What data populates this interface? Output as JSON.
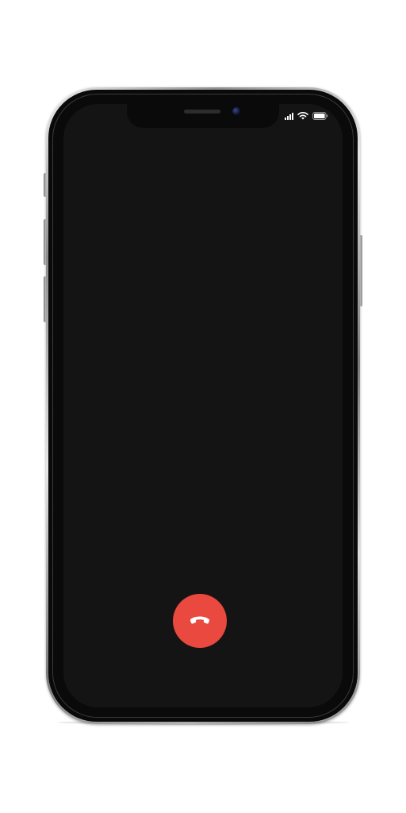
{
  "device": {
    "model": "phone-mockup",
    "screen_background": "#141414",
    "frame_color": "silver"
  },
  "status_bar": {
    "icons": [
      "cellular-signal-icon",
      "wifi-icon",
      "battery-icon"
    ],
    "icon_color": "#ffffff"
  },
  "call_controls": {
    "end_call": {
      "icon": "phone-hangup-icon",
      "color": "#e9493e",
      "icon_color": "#ffffff"
    }
  }
}
